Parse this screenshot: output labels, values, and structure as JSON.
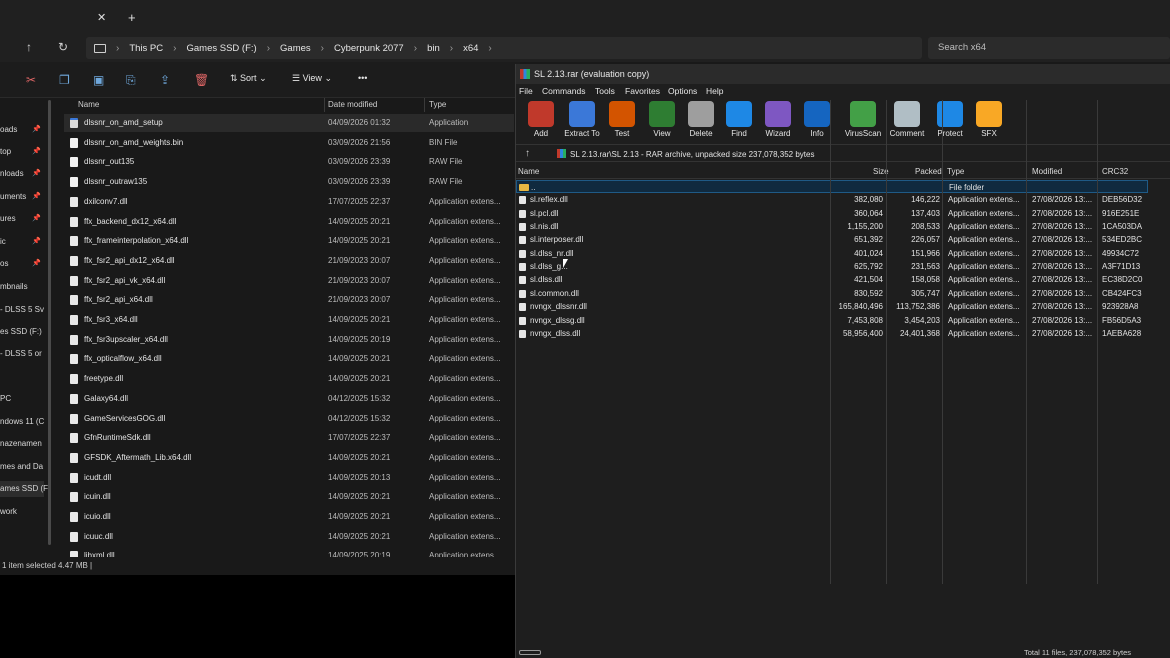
{
  "explorer": {
    "tab_close": "✕",
    "new_tab": "+",
    "breadcrumb": [
      "This PC",
      "Games SSD (F:)",
      "Games",
      "Cyberpunk 2077",
      "bin",
      "x64"
    ],
    "search_placeholder": "Search x64",
    "toolbar": {
      "sort_label": "Sort",
      "view_label": "View",
      "more_label": "•••"
    },
    "sidebar": [
      "oads",
      "top",
      "nloads",
      "uments",
      "ures",
      "ic",
      "os",
      "mbnails",
      "- DLSS 5 Sv",
      "es SSD (F:)",
      "- DLSS 5 or",
      "PC",
      "ndows 11 (C",
      "nazenamen",
      "mes and Da",
      "ames SSD (F:",
      "work"
    ],
    "columns": {
      "name": "Name",
      "date": "Date modified",
      "type": "Type"
    },
    "files": [
      {
        "name": "dlssnr_on_amd_setup",
        "date": "04/09/2026 01:32",
        "type": "Application",
        "icon": "app-icon"
      },
      {
        "name": "dlssnr_on_amd_weights.bin",
        "date": "03/09/2026 21:56",
        "type": "BIN File",
        "icon": "file-icon"
      },
      {
        "name": "dlssnr_out135",
        "date": "03/09/2026 23:39",
        "type": "RAW File",
        "icon": "file-icon"
      },
      {
        "name": "dlssnr_outraw135",
        "date": "03/09/2026 23:39",
        "type": "RAW File",
        "icon": "file-icon"
      },
      {
        "name": "dxilconv7.dll",
        "date": "17/07/2025 22:37",
        "type": "Application extens...",
        "icon": "dll-icon"
      },
      {
        "name": "ffx_backend_dx12_x64.dll",
        "date": "14/09/2025 20:21",
        "type": "Application extens...",
        "icon": "dll-icon"
      },
      {
        "name": "ffx_frameinterpolation_x64.dll",
        "date": "14/09/2025 20:21",
        "type": "Application extens...",
        "icon": "dll-icon"
      },
      {
        "name": "ffx_fsr2_api_dx12_x64.dll",
        "date": "21/09/2023 20:07",
        "type": "Application extens...",
        "icon": "dll-icon"
      },
      {
        "name": "ffx_fsr2_api_vk_x64.dll",
        "date": "21/09/2023 20:07",
        "type": "Application extens...",
        "icon": "dll-icon"
      },
      {
        "name": "ffx_fsr2_api_x64.dll",
        "date": "21/09/2023 20:07",
        "type": "Application extens...",
        "icon": "dll-icon"
      },
      {
        "name": "ffx_fsr3_x64.dll",
        "date": "14/09/2025 20:21",
        "type": "Application extens...",
        "icon": "dll-icon"
      },
      {
        "name": "ffx_fsr3upscaler_x64.dll",
        "date": "14/09/2025 20:19",
        "type": "Application extens...",
        "icon": "dll-icon"
      },
      {
        "name": "ffx_opticalflow_x64.dll",
        "date": "14/09/2025 20:21",
        "type": "Application extens...",
        "icon": "dll-icon"
      },
      {
        "name": "freetype.dll",
        "date": "14/09/2025 20:21",
        "type": "Application extens...",
        "icon": "dll-icon"
      },
      {
        "name": "Galaxy64.dll",
        "date": "04/12/2025 15:32",
        "type": "Application extens...",
        "icon": "dll-icon"
      },
      {
        "name": "GameServicesGOG.dll",
        "date": "04/12/2025 15:32",
        "type": "Application extens...",
        "icon": "dll-icon"
      },
      {
        "name": "GfnRuntimeSdk.dll",
        "date": "17/07/2025 22:37",
        "type": "Application extens...",
        "icon": "dll-icon"
      },
      {
        "name": "GFSDK_Aftermath_Lib.x64.dll",
        "date": "14/09/2025 20:21",
        "type": "Application extens...",
        "icon": "dll-icon"
      },
      {
        "name": "icudt.dll",
        "date": "14/09/2025 20:13",
        "type": "Application extens...",
        "icon": "dll-icon"
      },
      {
        "name": "icuin.dll",
        "date": "14/09/2025 20:21",
        "type": "Application extens...",
        "icon": "dll-icon"
      },
      {
        "name": "icuio.dll",
        "date": "14/09/2025 20:21",
        "type": "Application extens...",
        "icon": "dll-icon"
      },
      {
        "name": "icuuc.dll",
        "date": "14/09/2025 20:21",
        "type": "Application extens...",
        "icon": "dll-icon"
      },
      {
        "name": "libxml.dll",
        "date": "14/09/2025 20:19",
        "type": "Application extens...",
        "icon": "dll-icon"
      }
    ],
    "status": "1 item selected  4.47 MB  |"
  },
  "winrar": {
    "title": "SL 2.13.rar (evaluation copy)",
    "menu": [
      "File",
      "Commands",
      "Tools",
      "Favorites",
      "Options",
      "Help"
    ],
    "tools": [
      {
        "label": "Add",
        "icon": "add-icon",
        "color": "#c0392b"
      },
      {
        "label": "Extract To",
        "icon": "extract-icon",
        "color": "#3b78d8"
      },
      {
        "label": "Test",
        "icon": "test-icon",
        "color": "#d35400"
      },
      {
        "label": "View",
        "icon": "view-icon",
        "color": "#2e7d32"
      },
      {
        "label": "Delete",
        "icon": "delete-icon",
        "color": "#9e9e9e"
      },
      {
        "label": "Find",
        "icon": "find-icon",
        "color": "#1e88e5"
      },
      {
        "label": "Wizard",
        "icon": "wizard-icon",
        "color": "#7e57c2"
      },
      {
        "label": "Info",
        "icon": "info-icon",
        "color": "#1565c0"
      },
      {
        "label": "VirusScan",
        "icon": "virusscan-icon",
        "color": "#43a047"
      },
      {
        "label": "Comment",
        "icon": "comment-icon",
        "color": "#b0bec5"
      },
      {
        "label": "Protect",
        "icon": "protect-icon",
        "color": "#1e88e5"
      },
      {
        "label": "SFX",
        "icon": "sfx-icon",
        "color": "#f9a825"
      }
    ],
    "path": "SL 2.13.rar\\SL 2.13 - RAR archive, unpacked size 237,078,352 bytes",
    "columns": {
      "name": "Name",
      "size": "Size",
      "packed": "Packed",
      "type": "Type",
      "modified": "Modified",
      "crc": "CRC32"
    },
    "rows": [
      {
        "name": "..",
        "size": "",
        "packed": "",
        "type": "File folder",
        "modified": "",
        "crc": "",
        "folder": true
      },
      {
        "name": "sl.reflex.dll",
        "size": "382,080",
        "packed": "146,222",
        "type": "Application extens...",
        "modified": "27/08/2026 13:...",
        "crc": "DEB56D32"
      },
      {
        "name": "sl.pcl.dll",
        "size": "360,064",
        "packed": "137,403",
        "type": "Application extens...",
        "modified": "27/08/2026 13:...",
        "crc": "916E251E"
      },
      {
        "name": "sl.nis.dll",
        "size": "1,155,200",
        "packed": "208,533",
        "type": "Application extens...",
        "modified": "27/08/2026 13:...",
        "crc": "1CA503DA"
      },
      {
        "name": "sl.interposer.dll",
        "size": "651,392",
        "packed": "226,057",
        "type": "Application extens...",
        "modified": "27/08/2026 13:...",
        "crc": "534ED2BC"
      },
      {
        "name": "sl.dlss_nr.dll",
        "size": "401,024",
        "packed": "151,966",
        "type": "Application extens...",
        "modified": "27/08/2026 13:...",
        "crc": "49934C72"
      },
      {
        "name": "sl.dlss_g...",
        "size": "625,792",
        "packed": "231,563",
        "type": "Application extens...",
        "modified": "27/08/2026 13:...",
        "crc": "A3F71D13"
      },
      {
        "name": "sl.dlss.dll",
        "size": "421,504",
        "packed": "158,058",
        "type": "Application extens...",
        "modified": "27/08/2026 13:...",
        "crc": "EC38D2C0"
      },
      {
        "name": "sl.common.dll",
        "size": "830,592",
        "packed": "305,747",
        "type": "Application extens...",
        "modified": "27/08/2026 13:...",
        "crc": "CB424FC3"
      },
      {
        "name": "nvngx_dlssnr.dll",
        "size": "165,840,496",
        "packed": "113,752,386",
        "type": "Application extens...",
        "modified": "27/08/2026 13:...",
        "crc": "923928A8"
      },
      {
        "name": "nvngx_dlssg.dll",
        "size": "7,453,808",
        "packed": "3,454,203",
        "type": "Application extens...",
        "modified": "27/08/2026 13:...",
        "crc": "FB56D5A3"
      },
      {
        "name": "nvngx_dlss.dll",
        "size": "58,956,400",
        "packed": "24,401,368",
        "type": "Application extens...",
        "modified": "27/08/2026 13:...",
        "crc": "1AEBA628"
      }
    ],
    "status": "Total 11 files, 237,078,352 bytes"
  }
}
